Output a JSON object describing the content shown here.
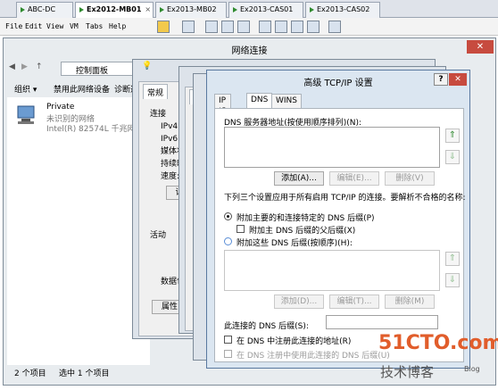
{
  "vm_tabs": [
    {
      "label": "ABC-DC",
      "active": false
    },
    {
      "label": "Ex2012-MB01",
      "active": true
    },
    {
      "label": "Ex2013-MB02",
      "active": false
    },
    {
      "label": "Ex2013-CAS01",
      "active": false
    },
    {
      "label": "Ex2013-CAS02",
      "active": false
    }
  ],
  "menu": {
    "file": "File",
    "edit": "Edit",
    "view": "View",
    "vm": "VM",
    "tabs": "Tabs",
    "help": "Help"
  },
  "explorer": {
    "title": "网络连接",
    "close": "✕",
    "breadcrumb": "控制面板",
    "cmd_org": "组织 ▾",
    "cmd_disable": "禁用此网络设备",
    "cmd_diag": "诊断这",
    "item_name": "Private",
    "item_status": "未识别的网络",
    "item_adapter": "Intel(R) 82574L 千兆网络",
    "status_count": "2 个项目",
    "status_selected": "选中 1 个项目"
  },
  "status_win": {
    "tab": "常规",
    "conn": "连接",
    "ipv4": "IPv4 连",
    "ipv6": "IPv6 连",
    "media": "媒体状",
    "duration": "持续时",
    "speed": "速度:",
    "detail_btn": "详",
    "activity": "活动",
    "packets": "数据包",
    "prop_btn": "属性"
  },
  "prop_win": {
    "tab": "网"
  },
  "dialog": {
    "title": "高级 TCP/IP 设置",
    "help": "?",
    "close": "✕",
    "tabs": [
      "IP 设置",
      "DNS",
      "WINS"
    ],
    "dns_servers_label": "DNS 服务器地址(按使用顺序排列)(N):",
    "add_btn": "添加(A)...",
    "edit_btn": "编辑(E)...",
    "delete_btn": "删除(V)",
    "desc": "下列三个设置应用于所有启用 TCP/IP 的连接。要解析不合格的名称:",
    "radio1": "附加主要的和连接特定的 DNS 后缀(P)",
    "check_parent": "附加主 DNS 后缀的父后缀(X)",
    "radio2": "附加这些 DNS 后缀(按顺序)(H):",
    "add_btn2": "添加(D)...",
    "edit_btn2": "编辑(T)...",
    "delete_btn2": "删除(M)",
    "suffix_label": "此连接的 DNS 后缀(S):",
    "suffix_value": "",
    "check_register": "在 DNS 中注册此连接的地址(R)",
    "check_use_suffix": "在 DNS 注册中使用此连接的 DNS 后缀(U)"
  },
  "watermark": {
    "site": "51CTO.com",
    "tagline": "技术博客",
    "blog": "Blog"
  }
}
